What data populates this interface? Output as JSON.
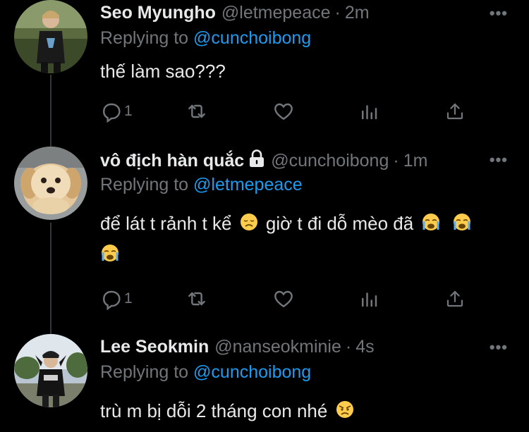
{
  "tweets": [
    {
      "name": "Seo Myungho",
      "handle": "@letmepeace",
      "dot": "·",
      "time": "2m",
      "replying_prefix": "Replying to",
      "replying_to": "@cunchoibong",
      "text": "thế làm sao???",
      "reply_count": "1",
      "avatar_icon": "person-photo-avatar"
    },
    {
      "name": "vô địch hàn quắc",
      "handle": "@cunchoibong",
      "dot": "·",
      "time": "1m",
      "replying_prefix": "Replying to",
      "replying_to": "@letmepeace",
      "text_line1": "để lát t rảnh t kể",
      "text_mid": "giờ t đi dỗ mèo đã",
      "reply_count": "1",
      "locked": true,
      "avatar_icon": "puppy-photo-avatar",
      "emojis": [
        "disappointed-face-emoji",
        "loudly-crying-face-emoji",
        "loudly-crying-face-emoji",
        "loudly-crying-face-emoji"
      ]
    },
    {
      "name": "Lee Seokmin",
      "handle": "@nanseokminie",
      "dot": "·",
      "time": "4s",
      "replying_prefix": "Replying to",
      "replying_to": "@cunchoibong",
      "text": "trù m bị dỗi 2 tháng con nhé",
      "avatar_icon": "person-photo-avatar",
      "emojis": [
        "angry-face-emoji"
      ]
    }
  ],
  "colors": {
    "background": "#000000",
    "primary_text": "#e7e9ea",
    "secondary_text": "#71767b",
    "accent": "#1d9bf0",
    "thread_line": "#333639"
  }
}
